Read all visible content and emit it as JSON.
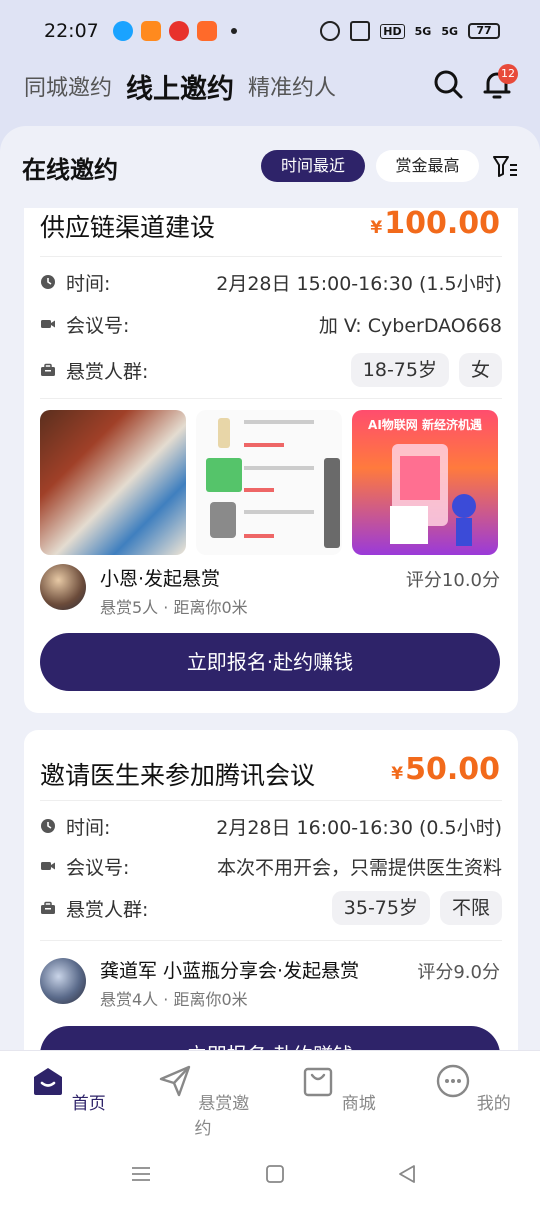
{
  "status": {
    "time": "22:07",
    "battery": "77",
    "net1": "5G",
    "net2": "5G",
    "hd": "HD"
  },
  "topnav": {
    "tabs": [
      "同城邀约",
      "线上邀约",
      "精准约人"
    ],
    "active": 1,
    "notif_count": "12"
  },
  "panel": {
    "title": "在线邀约",
    "sort_recent": "时间最近",
    "sort_reward": "赏金最高"
  },
  "cards": [
    {
      "title": "供应链渠道建设",
      "currency": "¥",
      "price": "100.00",
      "time_label": "时间:",
      "time_value": "2月28日 15:00-16:30 (1.5小时)",
      "meeting_label": "会议号:",
      "meeting_value": "加 V:  CyberDAO668",
      "crowd_label": "悬赏人群:",
      "tags": [
        "18-75岁",
        "女"
      ],
      "image3_text": "AI物联网 新经济机遇",
      "user_name": "小恩·发起悬赏",
      "user_sub": "悬赏5人 · 距离你0米",
      "score": "评分10.0分",
      "cta": "立即报名·赴约赚钱"
    },
    {
      "title": "邀请医生来参加腾讯会议",
      "currency": "¥",
      "price": "50.00",
      "time_label": "时间:",
      "time_value": "2月28日 16:00-16:30 (0.5小时)",
      "meeting_label": "会议号:",
      "meeting_value": "本次不用开会，只需提供医生资料",
      "crowd_label": "悬赏人群:",
      "tags": [
        "35-75岁",
        "不限"
      ],
      "user_name": "龚道军 小蓝瓶分享会·发起悬赏",
      "user_sub": "悬赏4人 · 距离你0米",
      "score": "评分9.0分",
      "cta": "立即报名·赴约赚钱"
    }
  ],
  "tabbar": {
    "items": [
      "首页",
      "悬赏邀约",
      "商城",
      "我的"
    ],
    "active": 0
  },
  "colors": {
    "primary": "#2e2369",
    "price": "#f26a1b",
    "background": "#dfe3f4"
  }
}
